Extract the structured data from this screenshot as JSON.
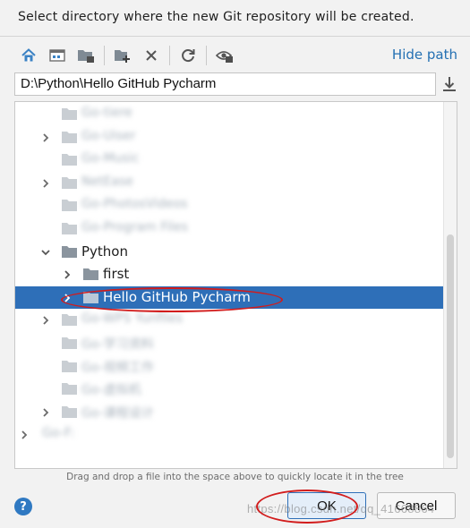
{
  "header": {
    "title": "Select directory where the new Git repository will be created."
  },
  "toolbar": {
    "buttons": [
      {
        "name": "home-icon"
      },
      {
        "name": "desktop-icon"
      },
      {
        "name": "project-folder-icon"
      },
      {
        "name": "new-folder-icon"
      },
      {
        "name": "delete-icon"
      },
      {
        "name": "refresh-icon"
      },
      {
        "name": "show-hidden-icon"
      }
    ],
    "hide_path_label": "Hide path"
  },
  "path_field": {
    "value": "D:\\Python\\Hello GitHub Pycharm"
  },
  "tree": {
    "rows": [
      {
        "label": "Go-tiere",
        "blurred": true,
        "expandable": false
      },
      {
        "label": "Go-Uiser",
        "blurred": true,
        "expandable": true
      },
      {
        "label": "Go-Music",
        "blurred": true,
        "expandable": false
      },
      {
        "label": "NetEase",
        "blurred": true,
        "expandable": true
      },
      {
        "label": "Go-PhotosVideos",
        "blurred": true,
        "expandable": false
      },
      {
        "label": "Go-Program Files",
        "blurred": true,
        "expandable": false
      },
      {
        "label": "Python",
        "blurred": false,
        "expanded": true
      },
      {
        "label": "first",
        "blurred": false,
        "expandable": true
      },
      {
        "label": "Hello GitHub Pycharm",
        "blurred": false,
        "selected": true,
        "expandable": true
      },
      {
        "label": "Go-WPS Yunfiles",
        "blurred": true,
        "expandable": true
      },
      {
        "label": "Go-学习资料",
        "blurred": true,
        "expandable": false
      },
      {
        "label": "Go-视频工作",
        "blurred": true,
        "expandable": false
      },
      {
        "label": "Go-虚拟机",
        "blurred": true,
        "expandable": false
      },
      {
        "label": "Go-课程设计",
        "blurred": true,
        "expandable": true
      },
      {
        "label": "Go-F:",
        "blurred": true,
        "expandable": true
      }
    ]
  },
  "hint": "Drag and drop a file into the space above to quickly locate it in the tree",
  "buttons": {
    "help": "?",
    "ok": "OK",
    "cancel": "Cancel"
  },
  "watermark": "https://blog.csdn.net/qq_41668864",
  "colors": {
    "selection": "#2e6fb8",
    "link": "#2470b3",
    "annotation": "#d21c1c"
  }
}
